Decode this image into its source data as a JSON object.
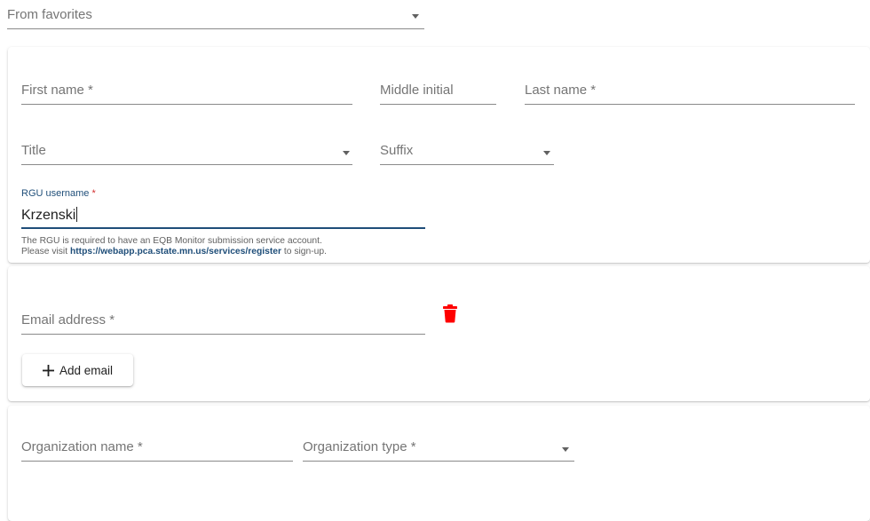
{
  "favorites": {
    "label": "From favorites"
  },
  "person": {
    "first_name_label": "First name *",
    "middle_initial_label": "Middle initial",
    "last_name_label": "Last name *",
    "title_label": "Title",
    "suffix_label": "Suffix",
    "rgu_label": "RGU username",
    "rgu_required": "*",
    "rgu_value": "Krzenski",
    "hint_line1": "The RGU is required to have an EQB Monitor submission service account.",
    "hint_line2_prefix": "Please visit ",
    "hint_link": "https://webapp.pca.state.mn.us/services/register",
    "hint_line2_suffix": " to sign-up."
  },
  "email": {
    "label": "Email address *",
    "delete_icon": "trash-icon",
    "add_button_label": "Add email",
    "add_icon": "plus-icon"
  },
  "organization": {
    "name_label": "Organization name *",
    "type_label": "Organization type *"
  },
  "colors": {
    "focus": "#1f4e79",
    "required": "#d32f2f",
    "delete": "#ff0000"
  }
}
